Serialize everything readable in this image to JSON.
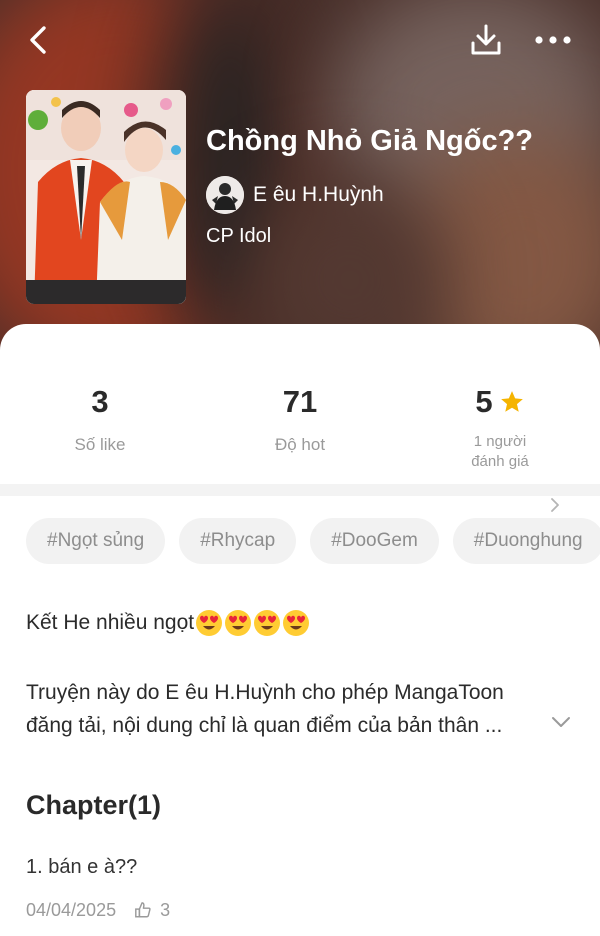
{
  "header": {
    "title": "Chồng Nhỏ Giả Ngốc??",
    "author": "E êu H.Huỳnh",
    "genre": "CP Idol",
    "icons": [
      "back-icon",
      "download-icon",
      "more-icon"
    ]
  },
  "stats": {
    "likes": {
      "value": "3",
      "label": "Số like"
    },
    "hot": {
      "value": "71",
      "label": "Độ hot"
    },
    "rating": {
      "value": "5",
      "label_line1": "1 người",
      "label_line2": "đánh giá"
    }
  },
  "tags": [
    "#Ngọt sủng",
    "#Rhycap",
    "#DooGem",
    "#Duonghung"
  ],
  "summary": {
    "line1": "Kết He nhiều ngọt",
    "line2": "Truyện này do E êu H.Huỳnh cho phép MangaToon",
    "line3": "đăng tải, nội dung chỉ là quan điểm của bản thân ..."
  },
  "chapters": {
    "heading": "Chapter(1)",
    "items": [
      {
        "title": "1. bán e à??",
        "date": "04/04/2025",
        "likes": "3"
      }
    ]
  },
  "colors": {
    "star": "#f5b400",
    "tag_bg": "#f2f2f2",
    "muted": "#9a9a9a"
  }
}
